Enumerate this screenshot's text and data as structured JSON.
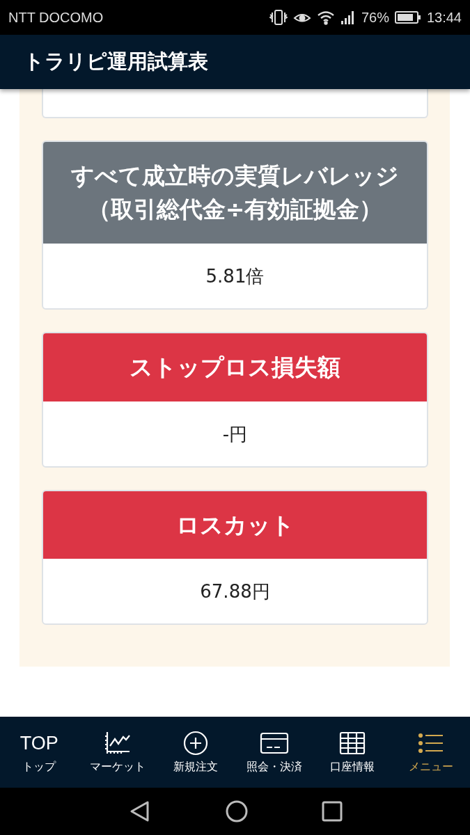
{
  "status_bar": {
    "carrier": "NTT DOCOMO",
    "battery": "76%",
    "time": "13:44"
  },
  "header": {
    "title": "トラリピ運用試算表"
  },
  "cards": [
    {
      "title_lines": [
        "すべて成立時の実質レバレッジ",
        "（取引総代金÷有効証拠金）"
      ],
      "value": "5.81倍",
      "color": "#6c757d"
    },
    {
      "title_lines": [
        "ストップロス損失額"
      ],
      "value": "-円",
      "color": "#dc3545"
    },
    {
      "title_lines": [
        "ロスカット"
      ],
      "value": "67.88円",
      "color": "#dc3545"
    }
  ],
  "bottom_nav": [
    {
      "kind": "text",
      "icon_text": "TOP",
      "label": "トップ",
      "selected": false
    },
    {
      "kind": "chart",
      "label": "マーケット",
      "selected": false
    },
    {
      "kind": "plus",
      "label": "新規注文",
      "selected": false
    },
    {
      "kind": "card",
      "label": "照会・決済",
      "selected": false
    },
    {
      "kind": "grid",
      "label": "口座情報",
      "selected": false
    },
    {
      "kind": "list",
      "label": "メニュー",
      "selected": true
    }
  ]
}
